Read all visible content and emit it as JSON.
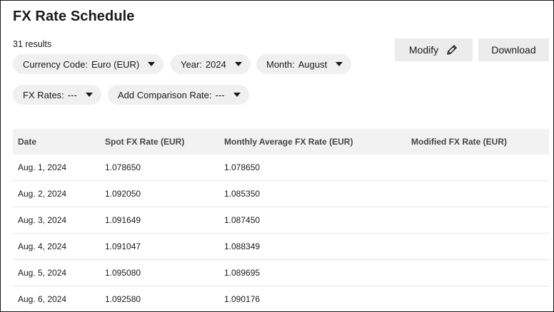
{
  "page": {
    "title": "FX Rate Schedule",
    "results": "31 results"
  },
  "filters": {
    "currency": {
      "label": "Currency Code:",
      "value": "Euro (EUR)"
    },
    "year": {
      "label": "Year:",
      "value": "2024"
    },
    "month": {
      "label": "Month:",
      "value": "August"
    },
    "fx_rates": {
      "label": "FX Rates:",
      "value": "---"
    },
    "comparison": {
      "label": "Add Comparison Rate:",
      "value": "---"
    }
  },
  "actions": {
    "modify": "Modify",
    "download": "Download"
  },
  "table": {
    "headers": [
      "Date",
      "Spot FX Rate (EUR)",
      "Monthly Average FX Rate (EUR)",
      "Modified FX Rate (EUR)"
    ],
    "rows": [
      [
        "Aug. 1, 2024",
        "1.078650",
        "1.078650",
        ""
      ],
      [
        "Aug. 2, 2024",
        "1.092050",
        "1.085350",
        ""
      ],
      [
        "Aug. 3, 2024",
        "1.091649",
        "1.087450",
        ""
      ],
      [
        "Aug. 4, 2024",
        "1.091047",
        "1.088349",
        ""
      ],
      [
        "Aug. 5, 2024",
        "1.095080",
        "1.089695",
        ""
      ],
      [
        "Aug. 6, 2024",
        "1.092580",
        "1.090176",
        ""
      ]
    ]
  },
  "icons": {
    "modify": "pencil-icon",
    "dropdown": "caret-down-icon"
  }
}
